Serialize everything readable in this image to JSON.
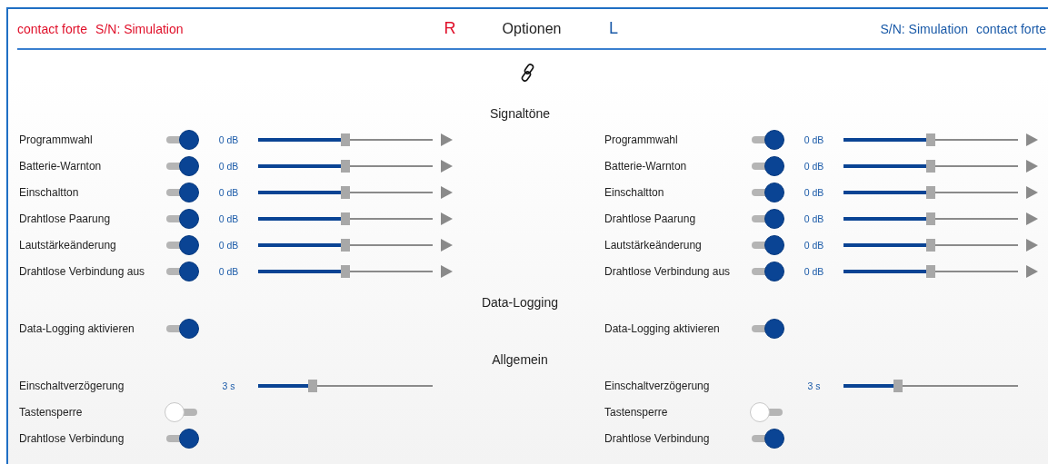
{
  "header": {
    "left_device": "contact forte",
    "left_serial": "S/N: Simulation",
    "right_side_label": "R",
    "title": "Optionen",
    "left_side_label": "L",
    "right_serial": "S/N: Simulation",
    "right_device": "contact forte"
  },
  "link": {
    "linked": true
  },
  "sections": [
    {
      "title": "Signaltöne",
      "sides": [
        {
          "rows": [
            {
              "kind": "toggle_slider",
              "label": "Programmwahl",
              "on": true,
              "value": "0 dB",
              "level": 0.5
            },
            {
              "kind": "toggle_slider",
              "label": "Batterie-Warnton",
              "on": true,
              "value": "0 dB",
              "level": 0.5
            },
            {
              "kind": "toggle_slider",
              "label": "Einschaltton",
              "on": true,
              "value": "0 dB",
              "level": 0.5
            },
            {
              "kind": "toggle_slider",
              "label": "Drahtlose Paarung",
              "on": true,
              "value": "0 dB",
              "level": 0.5
            },
            {
              "kind": "toggle_slider",
              "label": "Lautstärkeänderung",
              "on": true,
              "value": "0 dB",
              "level": 0.5
            },
            {
              "kind": "toggle_slider",
              "label": "Drahtlose Verbindung aus",
              "on": true,
              "value": "0 dB",
              "level": 0.5
            }
          ]
        },
        {
          "rows": [
            {
              "kind": "toggle_slider",
              "label": "Programmwahl",
              "on": true,
              "value": "0 dB",
              "level": 0.5
            },
            {
              "kind": "toggle_slider",
              "label": "Batterie-Warnton",
              "on": true,
              "value": "0 dB",
              "level": 0.5
            },
            {
              "kind": "toggle_slider",
              "label": "Einschaltton",
              "on": true,
              "value": "0 dB",
              "level": 0.5
            },
            {
              "kind": "toggle_slider",
              "label": "Drahtlose Paarung",
              "on": true,
              "value": "0 dB",
              "level": 0.5
            },
            {
              "kind": "toggle_slider",
              "label": "Lautstärkeänderung",
              "on": true,
              "value": "0 dB",
              "level": 0.5
            },
            {
              "kind": "toggle_slider",
              "label": "Drahtlose Verbindung aus",
              "on": true,
              "value": "0 dB",
              "level": 0.5
            }
          ]
        }
      ]
    },
    {
      "title": "Data-Logging",
      "sides": [
        {
          "rows": [
            {
              "kind": "toggle",
              "label": "Data-Logging aktivieren",
              "on": true
            }
          ]
        },
        {
          "rows": [
            {
              "kind": "toggle",
              "label": "Data-Logging aktivieren",
              "on": true
            }
          ]
        }
      ]
    },
    {
      "title": "Allgemein",
      "sides": [
        {
          "rows": [
            {
              "kind": "slider",
              "label": "Einschaltverzögerung",
              "value": "3 s",
              "level": 0.31
            },
            {
              "kind": "toggle",
              "label": "Tastensperre",
              "on": false
            },
            {
              "kind": "toggle",
              "label": "Drahtlose Verbindung",
              "on": true
            }
          ]
        },
        {
          "rows": [
            {
              "kind": "slider",
              "label": "Einschaltverzögerung",
              "value": "3 s",
              "level": 0.31
            },
            {
              "kind": "toggle",
              "label": "Tastensperre",
              "on": false
            },
            {
              "kind": "toggle",
              "label": "Drahtlose Verbindung",
              "on": true
            }
          ]
        }
      ]
    }
  ]
}
